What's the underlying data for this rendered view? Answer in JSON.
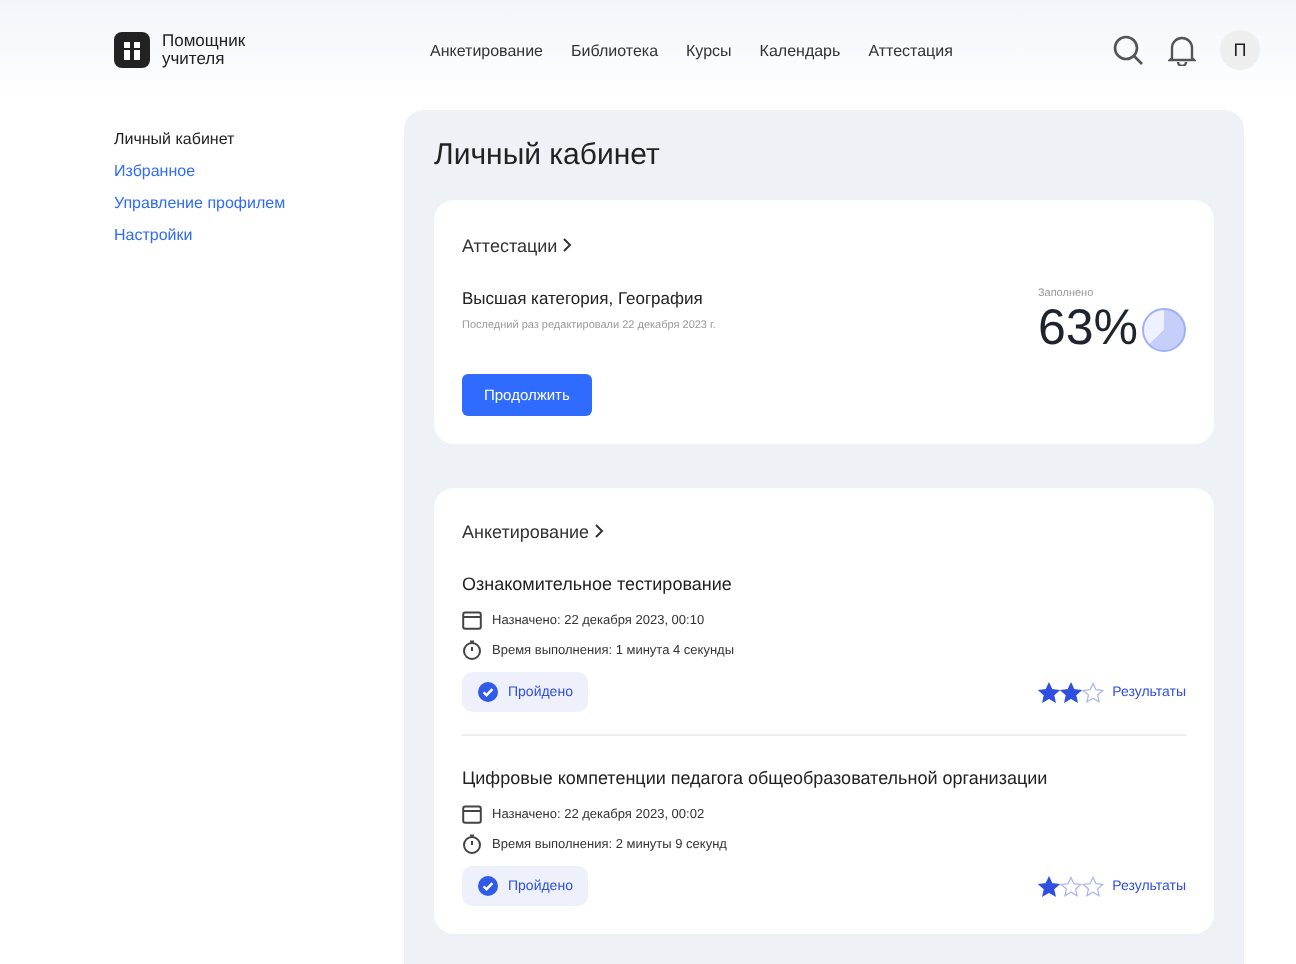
{
  "header": {
    "logo_text": "Помощник учителя",
    "nav": [
      {
        "label": "Анкетирование"
      },
      {
        "label": "Библиотека"
      },
      {
        "label": "Курсы"
      },
      {
        "label": "Календарь"
      },
      {
        "label": "Аттестация"
      }
    ],
    "avatar": "П"
  },
  "sidebar": {
    "items": [
      {
        "label": "Личный кабинет",
        "selected": true
      },
      {
        "label": "Избранное",
        "selected": false
      },
      {
        "label": "Управление профилем",
        "selected": false
      },
      {
        "label": "Настройки",
        "selected": false
      }
    ]
  },
  "page_title": "Личный кабинет",
  "attestation": {
    "heading": "Аттестации",
    "title": "Высшая категория, География",
    "edited": "Последний раз редактировали 22 декабря 2023 г.",
    "button": "Продолжить",
    "progress_label": "Заполнено",
    "percent": "63%"
  },
  "surveys": {
    "heading": "Анкетирование",
    "items": [
      {
        "title": "Ознакомительное тестирование",
        "assigned": "Назначено:  22 декабря 2023, 00:10",
        "duration": "Время выполнения: 1 минута 4 секунды",
        "status": "Пройдено",
        "stars": 2,
        "results": "Результаты"
      },
      {
        "title": "Цифровые компетенции педагога общеобразовательной организации",
        "assigned": "Назначено:  22 декабря 2023, 00:02",
        "duration": "Время выполнения: 2 минуты 9 секунд",
        "status": "Пройдено",
        "stars": 1,
        "results": "Результаты"
      }
    ]
  }
}
